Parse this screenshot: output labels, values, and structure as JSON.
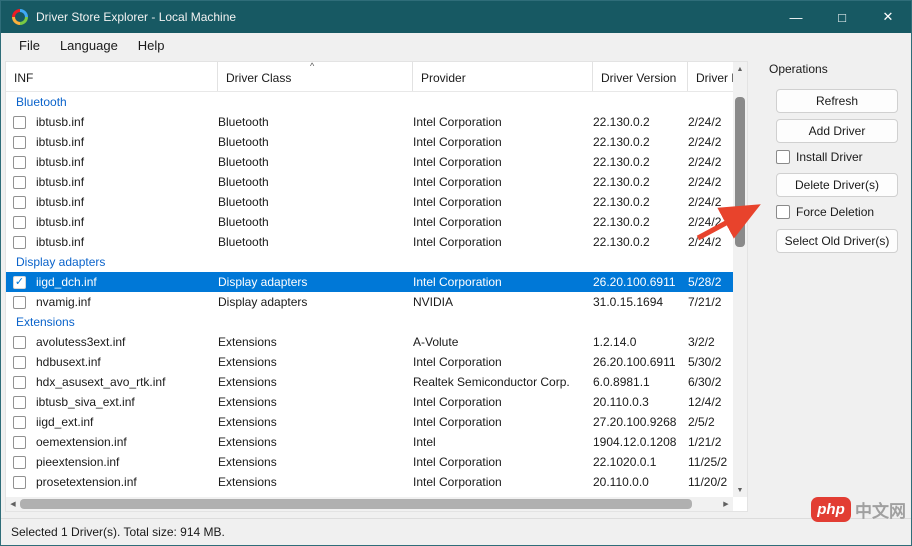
{
  "window": {
    "title": "Driver Store Explorer - Local Machine",
    "controls": {
      "minimize": "—",
      "maximize": "□",
      "close": "✕"
    }
  },
  "menu": {
    "items": [
      "File",
      "Language",
      "Help"
    ]
  },
  "table": {
    "columns": [
      "INF",
      "Driver Class",
      "Provider",
      "Driver Version",
      "Driver D"
    ],
    "sort_indicator": "^",
    "groups": [
      {
        "label": "Bluetooth",
        "rows": [
          {
            "inf": "ibtusb.inf",
            "driver_class": "Bluetooth",
            "provider": "Intel Corporation",
            "version": "22.130.0.2",
            "date": "2/24/2",
            "checked": false,
            "selected": false
          },
          {
            "inf": "ibtusb.inf",
            "driver_class": "Bluetooth",
            "provider": "Intel Corporation",
            "version": "22.130.0.2",
            "date": "2/24/2",
            "checked": false,
            "selected": false
          },
          {
            "inf": "ibtusb.inf",
            "driver_class": "Bluetooth",
            "provider": "Intel Corporation",
            "version": "22.130.0.2",
            "date": "2/24/2",
            "checked": false,
            "selected": false
          },
          {
            "inf": "ibtusb.inf",
            "driver_class": "Bluetooth",
            "provider": "Intel Corporation",
            "version": "22.130.0.2",
            "date": "2/24/2",
            "checked": false,
            "selected": false
          },
          {
            "inf": "ibtusb.inf",
            "driver_class": "Bluetooth",
            "provider": "Intel Corporation",
            "version": "22.130.0.2",
            "date": "2/24/2",
            "checked": false,
            "selected": false
          },
          {
            "inf": "ibtusb.inf",
            "driver_class": "Bluetooth",
            "provider": "Intel Corporation",
            "version": "22.130.0.2",
            "date": "2/24/2",
            "checked": false,
            "selected": false
          },
          {
            "inf": "ibtusb.inf",
            "driver_class": "Bluetooth",
            "provider": "Intel Corporation",
            "version": "22.130.0.2",
            "date": "2/24/2",
            "checked": false,
            "selected": false
          }
        ]
      },
      {
        "label": "Display adapters",
        "rows": [
          {
            "inf": "iigd_dch.inf",
            "driver_class": "Display adapters",
            "provider": "Intel Corporation",
            "version": "26.20.100.6911",
            "date": "5/28/2",
            "checked": true,
            "selected": true
          },
          {
            "inf": "nvamig.inf",
            "driver_class": "Display adapters",
            "provider": "NVIDIA",
            "version": "31.0.15.1694",
            "date": "7/21/2",
            "checked": false,
            "selected": false
          }
        ]
      },
      {
        "label": "Extensions",
        "rows": [
          {
            "inf": "avolutess3ext.inf",
            "driver_class": "Extensions",
            "provider": "A-Volute",
            "version": "1.2.14.0",
            "date": "3/2/2",
            "checked": false,
            "selected": false
          },
          {
            "inf": "hdbusext.inf",
            "driver_class": "Extensions",
            "provider": "Intel Corporation",
            "version": "26.20.100.6911",
            "date": "5/30/2",
            "checked": false,
            "selected": false
          },
          {
            "inf": "hdx_asusext_avo_rtk.inf",
            "driver_class": "Extensions",
            "provider": "Realtek Semiconductor Corp.",
            "version": "6.0.8981.1",
            "date": "6/30/2",
            "checked": false,
            "selected": false
          },
          {
            "inf": "ibtusb_siva_ext.inf",
            "driver_class": "Extensions",
            "provider": "Intel Corporation",
            "version": "20.110.0.3",
            "date": "12/4/2",
            "checked": false,
            "selected": false
          },
          {
            "inf": "iigd_ext.inf",
            "driver_class": "Extensions",
            "provider": "Intel Corporation",
            "version": "27.20.100.9268",
            "date": "2/5/2",
            "checked": false,
            "selected": false
          },
          {
            "inf": "oemextension.inf",
            "driver_class": "Extensions",
            "provider": "Intel",
            "version": "1904.12.0.1208",
            "date": "1/21/2",
            "checked": false,
            "selected": false
          },
          {
            "inf": "pieextension.inf",
            "driver_class": "Extensions",
            "provider": "Intel Corporation",
            "version": "22.1020.0.1",
            "date": "11/25/2",
            "checked": false,
            "selected": false
          },
          {
            "inf": "prosetextension.inf",
            "driver_class": "Extensions",
            "provider": "Intel Corporation",
            "version": "20.110.0.0",
            "date": "11/20/2",
            "checked": false,
            "selected": false
          }
        ]
      }
    ]
  },
  "operations": {
    "title": "Operations",
    "refresh_label": "Refresh",
    "add_driver_label": "Add Driver",
    "install_driver_label": "Install Driver",
    "delete_drivers_label": "Delete Driver(s)",
    "force_deletion_label": "Force Deletion",
    "select_old_label": "Select Old Driver(s)"
  },
  "status_bar": {
    "text": "Selected 1 Driver(s). Total size: 914 MB."
  },
  "watermark": {
    "logo": "php",
    "site": "中文网"
  },
  "colors": {
    "titlebar": "#175963",
    "selection_blue": "#0078d7",
    "group_label_blue": "#0a63cb",
    "annotation_arrow_red": "#e8432c",
    "watermark_red": "#e23d33"
  }
}
